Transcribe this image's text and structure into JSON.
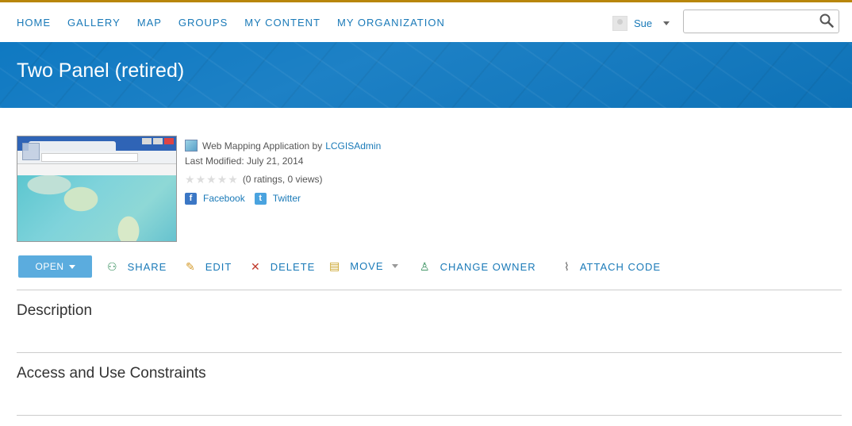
{
  "nav": {
    "links": [
      "HOME",
      "GALLERY",
      "MAP",
      "GROUPS",
      "MY CONTENT",
      "MY ORGANIZATION"
    ],
    "user": "Sue",
    "search_placeholder": ""
  },
  "banner": {
    "title": "Two Panel (retired)"
  },
  "item": {
    "type_text": "Web Mapping Application by",
    "owner": "LCGISAdmin",
    "last_modified": "Last Modified: July 21, 2014",
    "ratings_text": "(0 ratings, 0 views)",
    "rating": 0,
    "rating_max": 5,
    "facebook": "Facebook",
    "twitter": "Twitter"
  },
  "actions": {
    "open": "OPEN",
    "share": "SHARE",
    "edit": "EDIT",
    "delete": "DELETE",
    "move": "MOVE",
    "change_owner": "CHANGE OWNER",
    "attach_code": "ATTACH CODE"
  },
  "sections": {
    "description": "Description",
    "access": "Access and Use Constraints"
  },
  "colors": {
    "accent": "#1a7ab8",
    "banner": "#0f79c2",
    "open_button": "#5bacde",
    "delete_icon": "#c0392b",
    "top_line": "#b8860b"
  }
}
